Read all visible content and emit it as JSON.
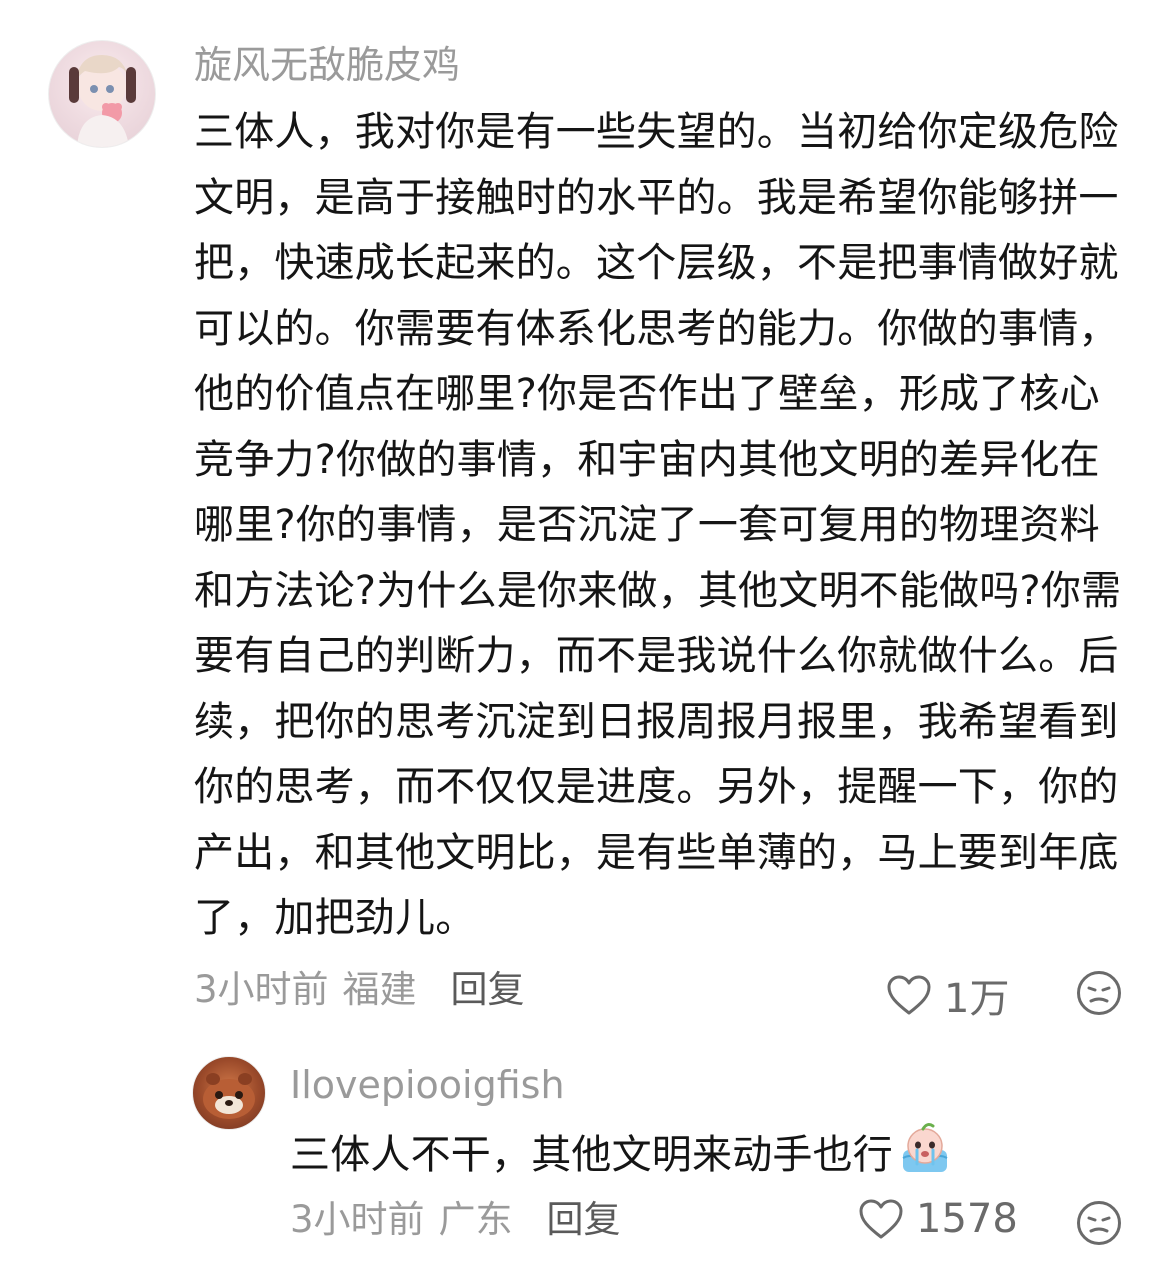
{
  "comments": [
    {
      "username": "旋风无敌脆皮鸡",
      "text": "三体人，我对你是有一些失望的。当初给你定级危险文明，是高于接触时的水平的。我是希望你能够拼一把，快速成长起来的。这个层级，不是把事情做好就可以的。你需要有体系化思考的能力。你做的事情，他的价值点在哪里?你是否作出了壁垒，形成了核心竞争力?你做的事情，和宇宙内其他文明的差异化在哪里?你的事情，是否沉淀了一套可复用的物理资料和方法论?为什么是你来做，其他文明不能做吗?你需要有自己的判断力，而不是我说什么你就做什么。后续，把你的思考沉淀到日报周报月报里，我希望看到你的思考，而不仅仅是进度。另外，提醒一下，你的产出，和其他文明比，是有些单薄的，马上要到年底了，加把劲儿。",
      "time": "3小时前",
      "location": "福建",
      "reply_label": "回复",
      "likes": "1万"
    },
    {
      "username": "Ilovepiooigfish",
      "text": "三体人不干，其他文明来动手也行",
      "emoji": "crying-face-emoji",
      "time": "3小时前",
      "location": "广东",
      "reply_label": "回复",
      "likes": "1578"
    }
  ],
  "colors": {
    "username": "#9a9a9a",
    "text": "#151515",
    "meta": "#9a9a9a",
    "reply_link": "#5a5a5a",
    "icon": "#6a6a6a"
  }
}
